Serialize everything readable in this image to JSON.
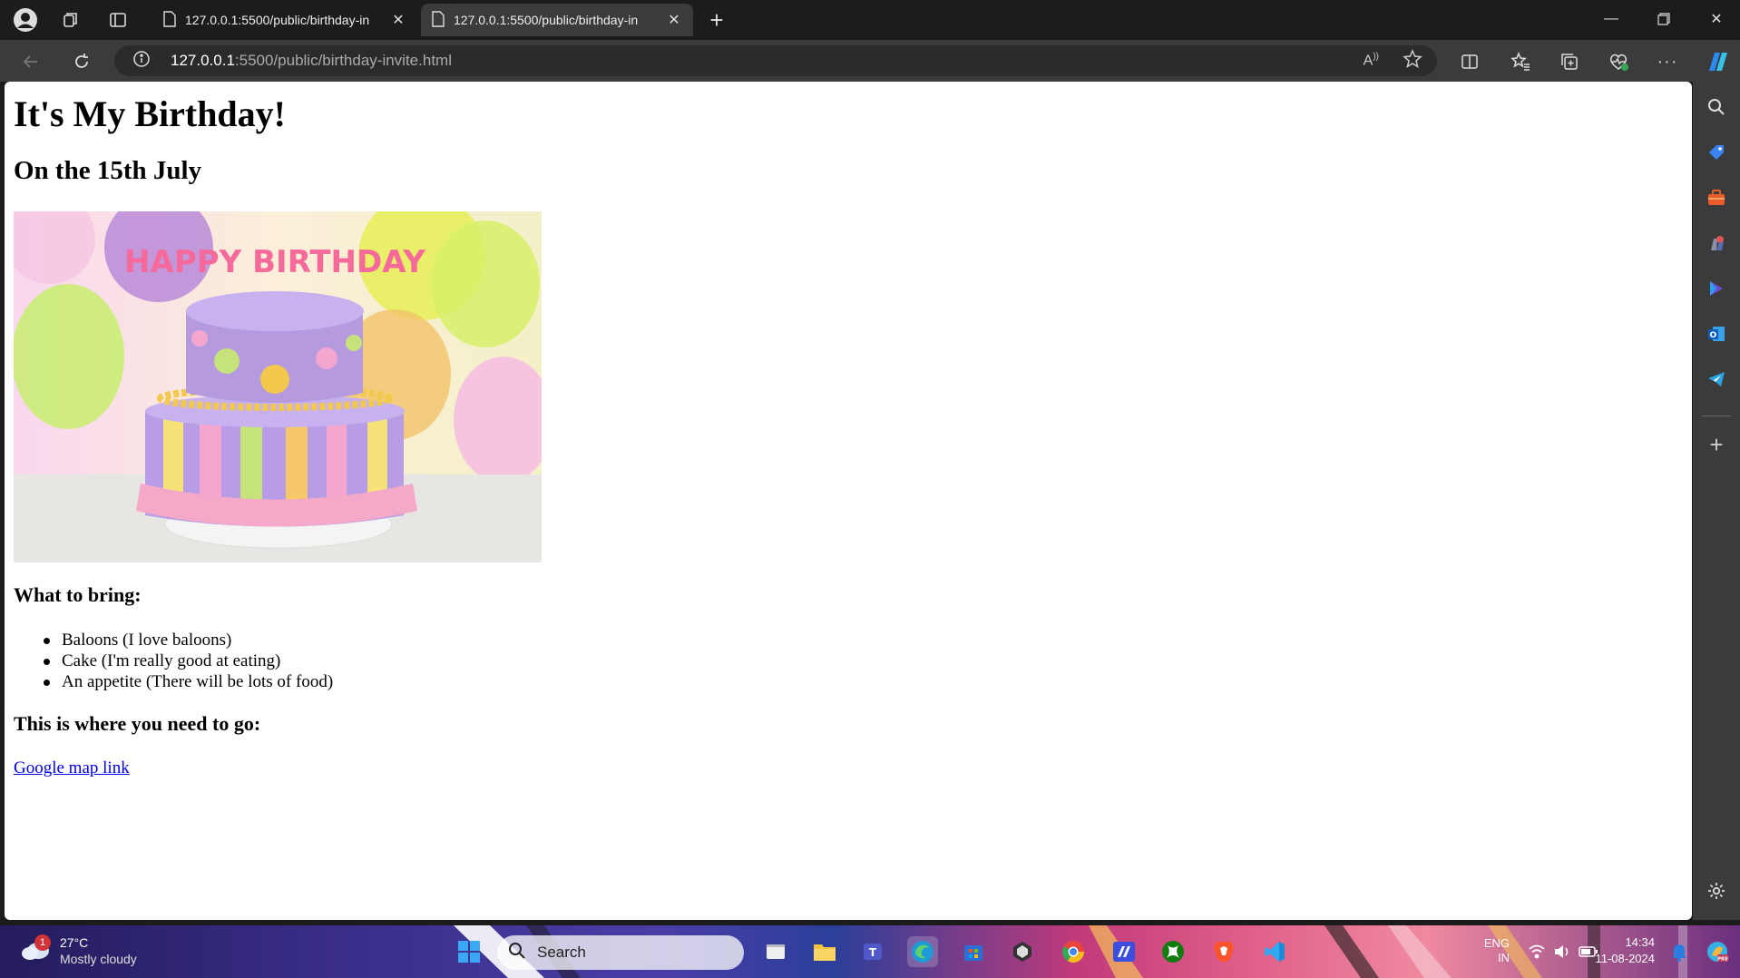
{
  "browser": {
    "tabs": [
      {
        "title": "127.0.0.1:5500/public/birthday-in",
        "active": false
      },
      {
        "title": "127.0.0.1:5500/public/birthday-in",
        "active": true
      }
    ],
    "address": {
      "host": "127.0.0.1",
      "rest": ":5500/public/birthday-invite.html"
    }
  },
  "page": {
    "title": "It's My Birthday!",
    "subtitle": "On the 15th July",
    "image": {
      "text": "HAPPY BIRTHDAY"
    },
    "bring_heading": "What to bring:",
    "bring_items": [
      "Baloons (I love baloons)",
      "Cake (I'm really good at eating)",
      "An appetite (There will be lots of food)"
    ],
    "where_heading": "This is where you need to go:",
    "map_link": "Google map link"
  },
  "sidebar": {
    "icons": [
      "search-icon",
      "shopping-tag-icon",
      "toolbox-icon",
      "games-icon",
      "copilot-icon",
      "outlook-icon",
      "telegram-icon",
      "add-icon",
      "settings-icon"
    ]
  },
  "taskbar": {
    "weather": {
      "temp": "27°C",
      "condition": "Mostly cloudy",
      "badge": "1"
    },
    "search_label": "Search",
    "language": "ENG",
    "language_region": "IN",
    "time": "14:34",
    "date": "11-08-2024",
    "icons": [
      "windows-start-icon",
      "task-view-icon",
      "file-explorer-icon",
      "teams-icon",
      "edge-icon",
      "microsoft-store-icon",
      "unity-icon",
      "chrome-icon",
      "vs-icon",
      "xbox-icon",
      "brave-icon",
      "vscode-icon"
    ]
  }
}
